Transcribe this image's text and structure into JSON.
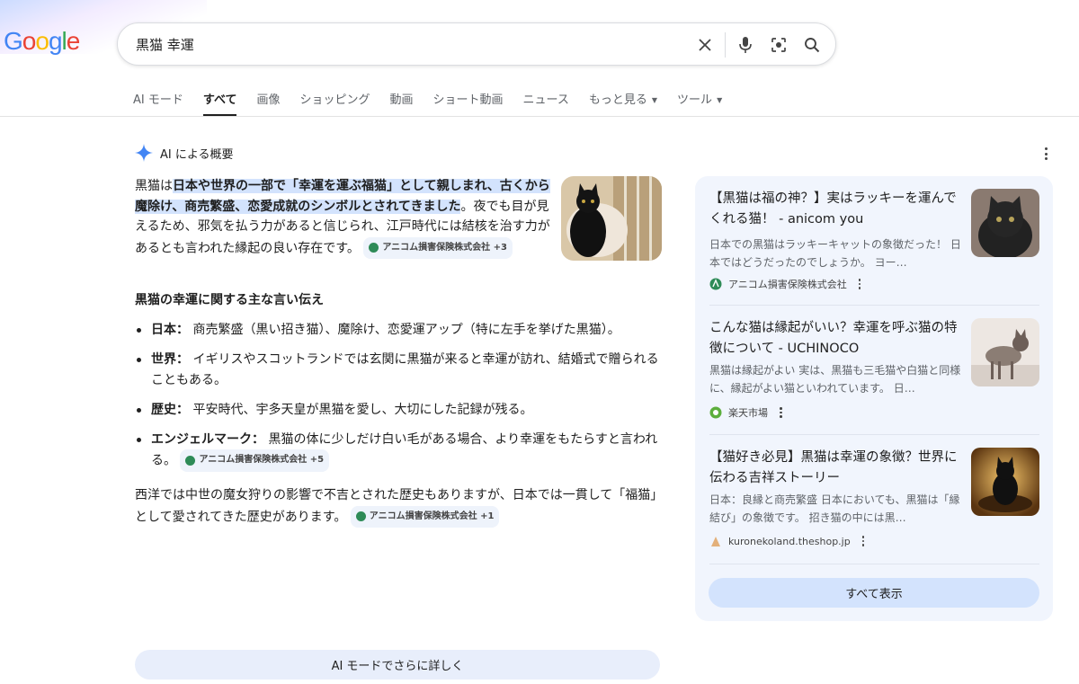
{
  "logo": {
    "letters": [
      "G",
      "o",
      "o",
      "g",
      "l",
      "e"
    ]
  },
  "search": {
    "query": "黒猫 幸運"
  },
  "tabs": [
    {
      "label": "AI モード"
    },
    {
      "label": "すべて"
    },
    {
      "label": "画像"
    },
    {
      "label": "ショッピング"
    },
    {
      "label": "動画"
    },
    {
      "label": "ショート動画"
    },
    {
      "label": "ニュース"
    },
    {
      "label": "もっと見る"
    },
    {
      "label": "ツール"
    }
  ],
  "overview": {
    "heading": "AI による概要",
    "intro_a": "黒猫は",
    "intro_highlight": "日本や世界の一部で「幸運を運ぶ福猫」として親しまれ、古くから魔除け、商売繁盛、恋愛成就のシンボルとされてきました",
    "intro_b": "。夜でも目が見えるため、邪気を払う力があると信じられ、江戸時代には結核を治す力があるとも言われた縁起の良い存在です。",
    "intro_chip": "アニコム損害保険株式会社 +3",
    "subheading": "黒猫の幸運に関する主な言い伝え",
    "bullets": [
      {
        "term": "日本：",
        "text": "商売繁盛（黒い招き猫）、魔除け、恋愛運アップ（特に左手を挙げた黒猫）。"
      },
      {
        "term": "世界：",
        "text": "イギリスやスコットランドでは玄関に黒猫が来ると幸運が訪れ、結婚式で贈られることもある。"
      },
      {
        "term": "歴史：",
        "text": "平安時代、宇多天皇が黒猫を愛し、大切にした記録が残る。"
      },
      {
        "term": "エンジェルマーク：",
        "text": "黒猫の体に少しだけ白い毛がある場合、より幸運をもたらすと言われる。",
        "chip": "アニコム損害保険株式会社 +5"
      }
    ],
    "outro": "西洋では中世の魔女狩りの影響で不吉とされた歴史もありますが、日本では一貫して「福猫」として愛されてきた歴史があります。",
    "outro_chip": "アニコム損害保険株式会社 +1",
    "more_button": "AI モードでさらに詳しく"
  },
  "sources": [
    {
      "title": "【黒猫は福の神？】実はラッキーを運んでくれる猫！ - anicom you",
      "snippet": "日本での黒猫はラッキーキャットの象徴だった！ 日本ではどうだったのでしょうか。 ヨー…",
      "site": "アニコム損害保険株式会社"
    },
    {
      "title": "こんな猫は縁起がいい？幸運を呼ぶ猫の特徴について - UCHINOCO",
      "snippet": "黒猫は縁起がよい 実は、黒猫も三毛猫や白猫と同様に、縁起がよい猫といわれています。 日…",
      "site": "楽天市場"
    },
    {
      "title": "【猫好き必見】黒猫は幸運の象徴？世界に伝わる吉祥ストーリー",
      "snippet": "日本：良縁と商売繁盛 日本においても、黒猫は「縁結び」の象徴です。 招き猫の中には黒…",
      "site": "kuronekoland.theshop.jp"
    }
  ],
  "show_all": "すべて表示",
  "colors": {
    "highlight": "#d3e3fd",
    "panel": "#f1f5fd",
    "accent": "#4285f4"
  }
}
